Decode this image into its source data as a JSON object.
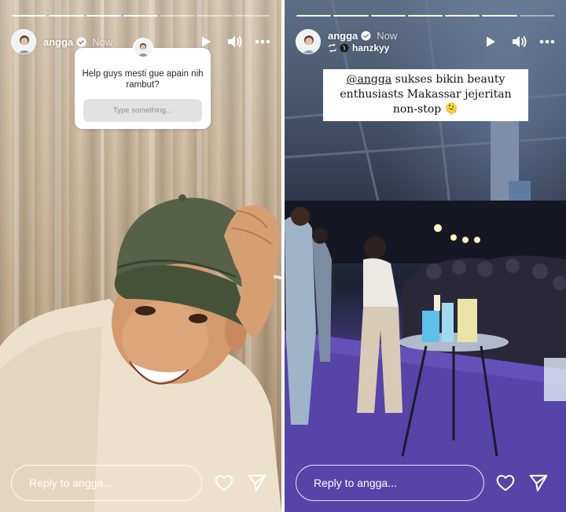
{
  "stories": [
    {
      "username": "angga",
      "time": "Now",
      "progress": {
        "total": 7,
        "done": 4
      },
      "question_sticker": {
        "question": "Help guys mesti gue apain nih rambut?",
        "placeholder": "Type something..."
      },
      "reply_placeholder": "Reply to angga..."
    },
    {
      "username": "angga",
      "time": "Now",
      "reposted_from": "hanzkyy",
      "progress": {
        "total": 7,
        "done": 6
      },
      "caption": {
        "mention": "@angga",
        "text": " sukses bikin beauty enthusiasts Makassar jejeritan non-stop ",
        "emoji": "🫠"
      },
      "reply_placeholder": "Reply to angga..."
    }
  ],
  "icons": {
    "play": "play-icon",
    "volume": "volume-icon",
    "more": "more-icon",
    "verified": "verified-badge-icon",
    "heart": "heart-icon",
    "send": "send-icon",
    "repost": "repost-icon"
  },
  "colors": {
    "verified": "#3897f0"
  }
}
